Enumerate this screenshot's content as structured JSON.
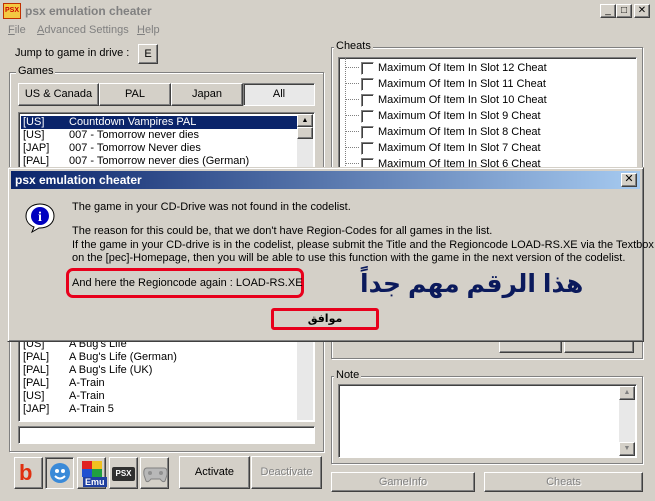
{
  "window": {
    "title": "psx emulation cheater",
    "icon_label": "PSX",
    "minimize_glyph": "_",
    "maximize_glyph": "□",
    "close_glyph": "✕"
  },
  "menu": {
    "items": [
      {
        "label": "File",
        "accel": "F",
        "rest": "ile"
      },
      {
        "label": "Advanced Settings",
        "accel": "A",
        "rest": "dvanced Settings"
      },
      {
        "label": "Help",
        "accel": "H",
        "rest": "elp"
      }
    ]
  },
  "drive": {
    "label": "Jump to game in drive :",
    "button_label": "E"
  },
  "games": {
    "group_label": "Games",
    "tabs": [
      {
        "label": "US & Canada",
        "active": false
      },
      {
        "label": "PAL",
        "active": false
      },
      {
        "label": "Japan",
        "active": false
      },
      {
        "label": "All",
        "active": true
      }
    ],
    "rows_top": [
      {
        "region": "[US]",
        "name": "Countdown Vampires PAL",
        "selected": true
      },
      {
        "region": "[US]",
        "name": "007 - Tomorrow never dies",
        "selected": false
      },
      {
        "region": "[JAP]",
        "name": "007 - Tomorrow Never dies",
        "selected": false
      },
      {
        "region": "[PAL]",
        "name": "007 - Tomorrow never dies (German)",
        "selected": false
      }
    ],
    "rows_bottom": [
      {
        "region": "[US]",
        "name": "A Bug's Life",
        "selected": false
      },
      {
        "region": "[PAL]",
        "name": "A Bug's Life (German)",
        "selected": false
      },
      {
        "region": "[PAL]",
        "name": "A Bug's Life (UK)",
        "selected": false
      },
      {
        "region": "[PAL]",
        "name": "A-Train",
        "selected": false
      },
      {
        "region": "[US]",
        "name": "A-Train",
        "selected": false
      },
      {
        "region": "[JAP]",
        "name": "A-Train 5",
        "selected": false
      }
    ],
    "search_value": ""
  },
  "cheats": {
    "group_label": "Cheats",
    "items": [
      "Maximum Of Item In Slot 12 Cheat",
      "Maximum Of Item In Slot 11 Cheat",
      "Maximum Of Item In Slot 10 Cheat",
      "Maximum Of Item In Slot 9 Cheat",
      "Maximum Of Item In Slot 8 Cheat",
      "Maximum Of Item In Slot 7 Cheat",
      "Maximum Of Item In Slot 6 Cheat"
    ]
  },
  "note": {
    "group_label": "Note",
    "value": ""
  },
  "toolbar": {
    "activate_label": "Activate",
    "deactivate_label": "Deactivate",
    "gameinfo_label": "GameInfo",
    "cheats_label": "Cheats",
    "icons": [
      "bleem-icon",
      "connectix-icon",
      "epsxe-icon",
      "psx-icon",
      "gamepad-icon"
    ],
    "icon_text": {
      "bleem": "b",
      "epsxe": "Emu",
      "psx": "PSX"
    }
  },
  "dialog": {
    "title": "psx emulation cheater",
    "close_glyph": "✕",
    "icon_glyph": "i",
    "line1": "The game in your CD-Drive was not found in the codelist.",
    "line2": "The reason for this could be, that we don't have Region-Codes for all games in the list.",
    "line3": "If the game in your CD-drive is in the codelist, please submit the Title and the Regioncode LOAD-RS.XE via the Textbox",
    "line4": "on the [pec]-Homepage, then you will be able to use this function with the game in the next version of the codelist.",
    "line5": "And here the Regioncode again : LOAD-RS.XE",
    "ok_label": "موافق",
    "annotation_arabic": "هذا الرقم مهم جداً",
    "colors": {
      "highlight_red": "#e8001c",
      "annotation_navy": "#0b1a5c",
      "title_blue": "#0a246a"
    }
  }
}
